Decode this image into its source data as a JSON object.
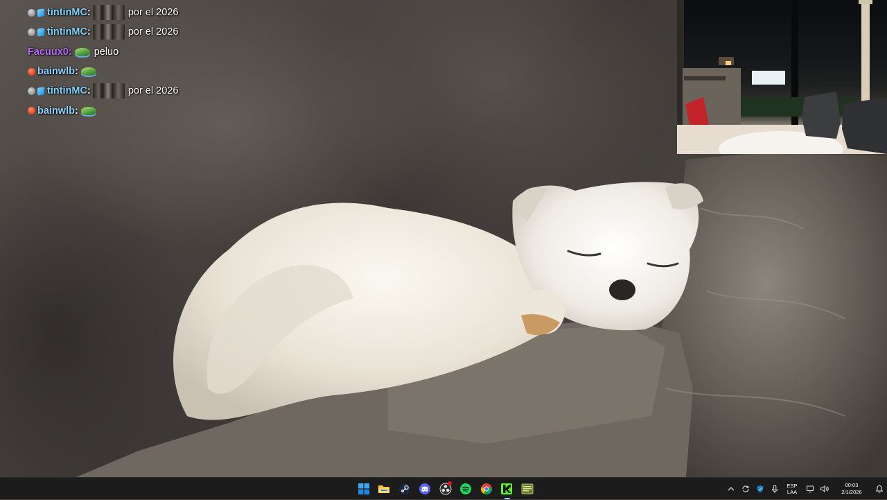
{
  "chat": {
    "messages": [
      {
        "badges": [
          "gray",
          "cube"
        ],
        "user": "tintinMC",
        "user_color": "#7fd3ff",
        "emote": "face",
        "text": "por el 2026"
      },
      {
        "badges": [
          "gray",
          "cube"
        ],
        "user": "tintinMC",
        "user_color": "#7fd3ff",
        "emote": "face",
        "text": "por el 2026"
      },
      {
        "badges": [],
        "user": "Facuux0",
        "user_color": "#b86cff",
        "emote": "leaf",
        "text": "peluo"
      },
      {
        "badges": [
          "red"
        ],
        "user": "bainwlb",
        "user_color": "#8fd0ff",
        "emote": "leaf",
        "text": ""
      },
      {
        "badges": [
          "gray",
          "cube"
        ],
        "user": "tintinMC",
        "user_color": "#7fd3ff",
        "emote": "face",
        "text": "por el 2026"
      },
      {
        "badges": [
          "red"
        ],
        "user": "bainwlb",
        "user_color": "#8fd0ff",
        "emote": "leaf",
        "text": ""
      }
    ]
  },
  "taskbar": {
    "apps": [
      {
        "name": "windows-start-icon"
      },
      {
        "name": "file-explorer-icon"
      },
      {
        "name": "steam-icon"
      },
      {
        "name": "discord-icon"
      },
      {
        "name": "obs-icon"
      },
      {
        "name": "spotify-icon"
      },
      {
        "name": "chrome-icon"
      },
      {
        "name": "kick-icon"
      },
      {
        "name": "notepad-icon"
      }
    ],
    "tray": {
      "language": "ESP",
      "layout": "LAA",
      "time": "00:03",
      "date": "2/1/2026"
    }
  }
}
